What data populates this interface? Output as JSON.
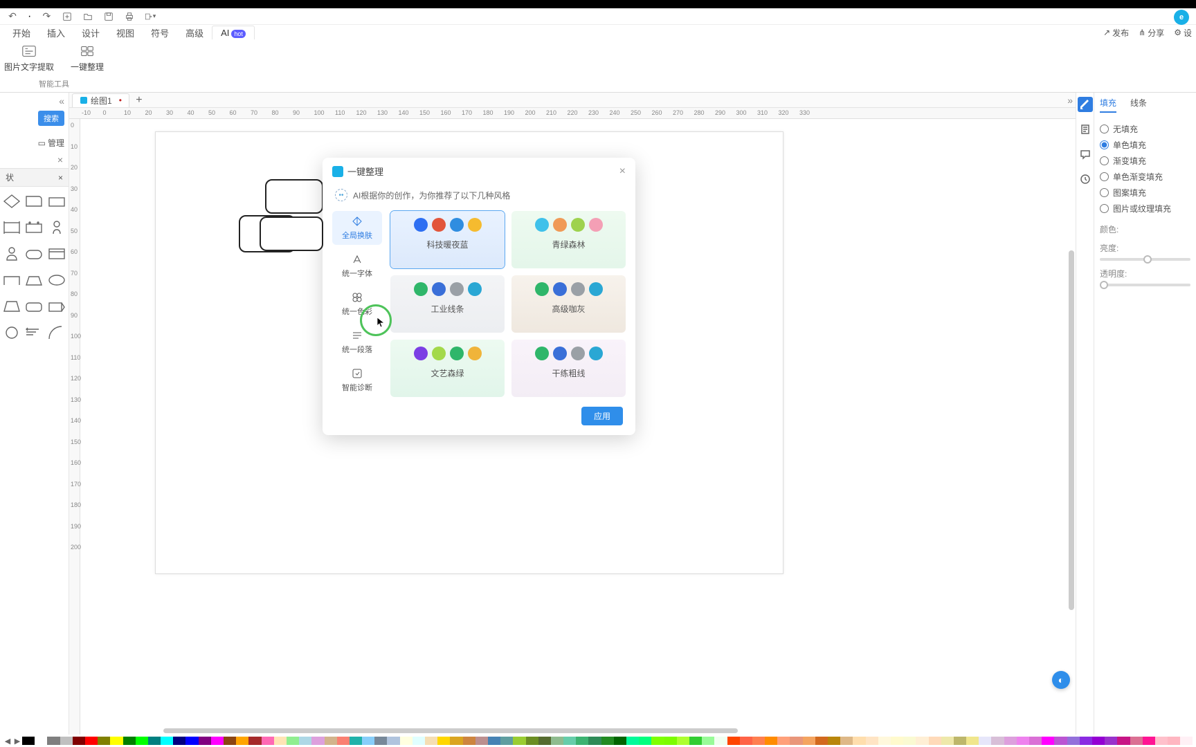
{
  "qat_icons": [
    "undo",
    "redo",
    "new",
    "open",
    "save",
    "print",
    "export"
  ],
  "menu": [
    "开始",
    "插入",
    "设计",
    "视图",
    "符号",
    "高级",
    "AI"
  ],
  "menu_active_index": 6,
  "ai_badge": "hot",
  "top_right": {
    "publish": "发布",
    "share": "分享",
    "settings": "设"
  },
  "ribbon": {
    "buttons": [
      {
        "key": "ocr",
        "label": "图片文字提取"
      },
      {
        "key": "tidy",
        "label": "一键整理"
      }
    ],
    "group_label": "智能工具"
  },
  "doc_tab": {
    "name": "绘图1",
    "dirty": "•"
  },
  "left_panel": {
    "search": "搜索",
    "manage": "管理",
    "category": "状"
  },
  "ruler_h": [
    -10,
    0,
    10,
    20,
    30,
    40,
    50,
    60,
    70,
    80,
    90,
    100,
    110,
    120,
    130,
    140,
    150,
    160,
    170,
    180,
    190,
    200,
    210,
    220,
    230,
    240,
    250,
    260,
    270,
    280,
    290,
    300,
    310,
    320,
    330
  ],
  "ruler_v": [
    0,
    10,
    20,
    30,
    40,
    50,
    60,
    70,
    80,
    90,
    100,
    110,
    120,
    130,
    140,
    150,
    160,
    170,
    180,
    190,
    200
  ],
  "dialog": {
    "title": "一键整理",
    "subtitle": "AI根据你的创作，为你推荐了以下几种风格",
    "side": [
      {
        "key": "skin",
        "label": "全局换肤"
      },
      {
        "key": "font",
        "label": "统一字体"
      },
      {
        "key": "color",
        "label": "统一色彩"
      },
      {
        "key": "para",
        "label": "统一段落"
      },
      {
        "key": "diag",
        "label": "智能诊断"
      }
    ],
    "side_active": 0,
    "styles": [
      {
        "name": "科技暖夜蓝",
        "bg": "linear-gradient(180deg,#e9f2ff,#dce9fb)",
        "colors": [
          "#2e6ff2",
          "#e2553b",
          "#2f8de0",
          "#f5bb2f"
        ],
        "selected": true
      },
      {
        "name": "青绿森林",
        "bg": "linear-gradient(180deg,#eefaf0,#e4f6ea)",
        "colors": [
          "#3fc1ea",
          "#f09a56",
          "#9ed24d",
          "#f49fb5"
        ]
      },
      {
        "name": "工业线条",
        "bg": "linear-gradient(180deg,#f3f4f6,#eceef1)",
        "colors": [
          "#2fb66a",
          "#3a6fd8",
          "#9aa0a6",
          "#2aa7d4"
        ]
      },
      {
        "name": "高级咖灰",
        "bg": "linear-gradient(180deg,#f7f2ec,#efe8df)",
        "colors": [
          "#2fb66a",
          "#3a6fd8",
          "#9aa0a6",
          "#2aa7d4"
        ]
      },
      {
        "name": "文艺森绿",
        "bg": "linear-gradient(180deg,#edfaf1,#e1f5ea)",
        "colors": [
          "#7b3fe4",
          "#a3d94a",
          "#2fb66a",
          "#f0b43a"
        ]
      },
      {
        "name": "干练粗线",
        "bg": "linear-gradient(180deg,#f9f3fa,#f3edf5)",
        "colors": [
          "#2fb66a",
          "#3a6fd8",
          "#9aa0a6",
          "#2aa7d4"
        ]
      }
    ],
    "apply": "应用"
  },
  "props": {
    "tabs": [
      "填充",
      "线条"
    ],
    "tab_active": 0,
    "fill_options": [
      "无填充",
      "单色填充",
      "渐变填充",
      "单色渐变填充",
      "图案填充",
      "图片或纹理填充"
    ],
    "fill_selected": 1,
    "color_label": "颜色:",
    "brightness_label": "亮度:",
    "opacity_label": "透明度:"
  },
  "bottom_colors": [
    "#000",
    "#fff",
    "#7f7f7f",
    "#c0c0c0",
    "#800000",
    "#f00",
    "#808000",
    "#ff0",
    "#008000",
    "#0f0",
    "#008080",
    "#0ff",
    "#000080",
    "#00f",
    "#800080",
    "#f0f",
    "#8b4513",
    "#ffa500",
    "#a52a2a",
    "#ff69b4",
    "#ffe4b5",
    "#90ee90",
    "#add8e6",
    "#dda0dd",
    "#d2b48c",
    "#fa8072",
    "#20b2aa",
    "#87cefa",
    "#778899",
    "#b0c4de",
    "#ffffe0",
    "#e0ffff",
    "#f5deb3",
    "#ffd700",
    "#daa520",
    "#cd853f",
    "#bc8f8f",
    "#4682b4",
    "#5f9ea0",
    "#9acd32",
    "#6b8e23",
    "#556b2f",
    "#8fbc8f",
    "#66cdaa",
    "#3cb371",
    "#2e8b57",
    "#228b22",
    "#006400",
    "#00fa9a",
    "#00ff7f",
    "#7fff00",
    "#7cfc00",
    "#adff2f",
    "#32cd32",
    "#98fb98",
    "#f0fff0",
    "#ff4500",
    "#ff6347",
    "#ff7f50",
    "#ff8c00",
    "#ffa07a",
    "#e9967a",
    "#f4a460",
    "#d2691e",
    "#b8860b",
    "#deb887",
    "#ffdead",
    "#ffe4c4",
    "#fff8dc",
    "#fffacd",
    "#fafad2",
    "#ffefd5",
    "#ffdab9",
    "#eee8aa",
    "#bdb76b",
    "#f0e68c",
    "#e6e6fa",
    "#d8bfd8",
    "#dda0dd",
    "#ee82ee",
    "#da70d6",
    "#ff00ff",
    "#ba55d3",
    "#9370db",
    "#8a2be2",
    "#9400d3",
    "#9932cc",
    "#c71585",
    "#db7093",
    "#ff1493",
    "#ffc0cb",
    "#ffb6c1",
    "#fff0f5"
  ]
}
